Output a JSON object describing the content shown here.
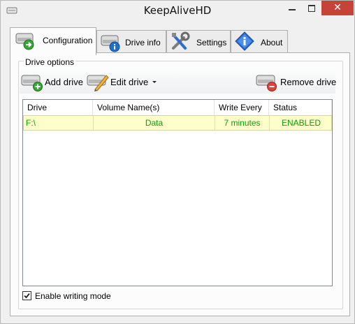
{
  "window": {
    "title": "KeepAliveHD",
    "close_glyph": "✕"
  },
  "tabs": [
    {
      "label": "Configuration",
      "icon": "drive-arrow-icon"
    },
    {
      "label": "Drive info",
      "icon": "drive-info-icon"
    },
    {
      "label": "Settings",
      "icon": "tools-icon"
    },
    {
      "label": "About",
      "icon": "info-diamond-icon"
    }
  ],
  "group": {
    "legend": "Drive options",
    "toolbar": {
      "add": "Add drive",
      "edit": "Edit drive",
      "remove": "Remove drive"
    }
  },
  "table": {
    "columns": [
      "Drive",
      "Volume Name(s)",
      "Write Every",
      "Status"
    ],
    "rows": [
      {
        "drive": "F:\\",
        "volume": "Data",
        "write_every": "7 minutes",
        "status": "ENABLED"
      }
    ],
    "row_text_color": "#0aa00a",
    "row_bg_color": "#fefecb"
  },
  "options": {
    "enable_writing_mode": {
      "label": "Enable writing mode",
      "checked": true
    }
  }
}
